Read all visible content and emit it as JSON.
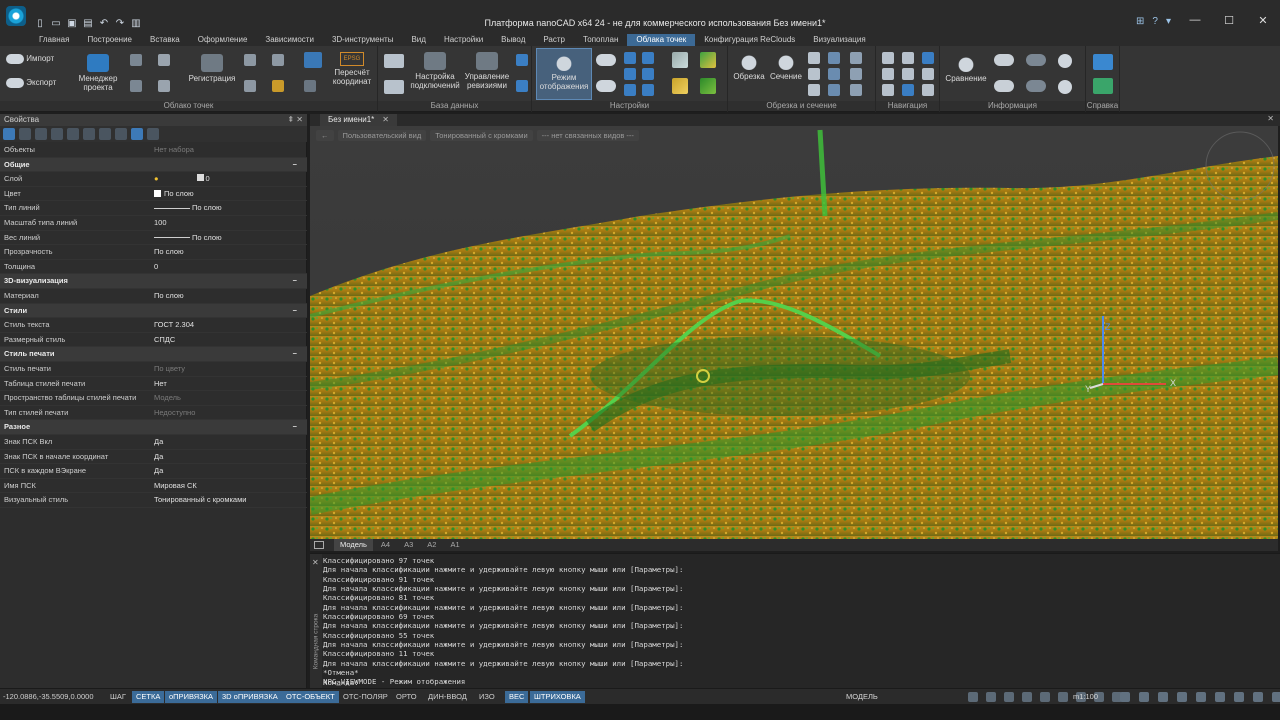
{
  "window": {
    "title": "Платформа nanoCAD x64 24 - не для коммерческого использования Без имени1*",
    "controls": [
      "—",
      "☐",
      "✕"
    ],
    "title_icons": [
      "⊞",
      "?",
      "▾"
    ]
  },
  "menu_tabs": [
    "Главная",
    "Построение",
    "Вставка",
    "Оформление",
    "Зависимости",
    "3D-инструменты",
    "Вид",
    "Настройки",
    "Вывод",
    "Растр",
    "Топоплан",
    "Облака точек",
    "Конфигурация ReClouds",
    "Визуализация"
  ],
  "active_menu_tab": "Облака точек",
  "ribbon": {
    "groups": {
      "cloud": "Облако точек",
      "database": "База данных",
      "settings": "Настройки",
      "clip": "Обрезка и сечение",
      "nav": "Навигация",
      "info": "Информация",
      "help_group": ""
    },
    "buttons": {
      "import": "Импорт",
      "export": "Экспорт",
      "project_manager": "Менеджер проекта",
      "registration": "Регистрация",
      "recalc": "Пересчёт координат",
      "epsg": "EPSG",
      "connections": "Настройка подключений",
      "revisions": "Управление ревизиями",
      "display_mode": "Режим отображения",
      "clip": "Обрезка",
      "section": "Сечение",
      "compare": "Сравнение",
      "help": "Справка"
    }
  },
  "properties": {
    "header": "Свойства",
    "header_icons": "⇞ ✕",
    "objects_label": "Объекты",
    "objects_value": "Нет набора",
    "sections": [
      {
        "title": "Общие",
        "rows": [
          {
            "k": "Слой",
            "v": "0"
          },
          {
            "k": "Цвет",
            "v": "По слою"
          },
          {
            "k": "Тип линий",
            "v": "По слою"
          },
          {
            "k": "Масштаб типа линий",
            "v": "100"
          },
          {
            "k": "Вес линий",
            "v": "По слою"
          },
          {
            "k": "Прозрачность",
            "v": "По слою"
          },
          {
            "k": "Толщина",
            "v": "0"
          }
        ]
      },
      {
        "title": "3D-визуализация",
        "rows": [
          {
            "k": "Материал",
            "v": "По слою"
          }
        ]
      },
      {
        "title": "Стили",
        "rows": [
          {
            "k": "Стиль текста",
            "v": "ГОСТ 2.304"
          },
          {
            "k": "Размерный стиль",
            "v": "СПДС"
          }
        ]
      },
      {
        "title": "Стиль печати",
        "rows": [
          {
            "k": "Стиль печати",
            "v": "По цвету",
            "dim": true
          },
          {
            "k": "Таблица стилей печати",
            "v": "Нет"
          },
          {
            "k": "Пространство таблицы стилей печати",
            "v": "Модель",
            "dim": true
          },
          {
            "k": "Тип стилей печати",
            "v": "Недоступно",
            "dim": true
          }
        ]
      },
      {
        "title": "Разное",
        "rows": [
          {
            "k": "Знак ПСК Вкл",
            "v": "Да"
          },
          {
            "k": "Знак ПСК в начале координат",
            "v": "Да"
          },
          {
            "k": "ПСК в каждом ВЭкране",
            "v": "Да"
          },
          {
            "k": "Имя ПСК",
            "v": "Мировая СК"
          },
          {
            "k": "Визуальный стиль",
            "v": "Тонированный с кромками"
          }
        ]
      }
    ]
  },
  "document": {
    "tab": "Без имени1*",
    "view_controls": [
      "←",
      "Пользовательский вид",
      "Тонированный с кромками",
      "--- нет связанных видов ---"
    ]
  },
  "axes": {
    "z": "Z",
    "x": "X",
    "y": "Y"
  },
  "layout_tabs": [
    "Модель",
    "A4",
    "A3",
    "A2",
    "A1"
  ],
  "command": {
    "side_label": "Командная строка",
    "lines": [
      "Классифицировано 97 точек",
      "Для начала классификации нажмите и удерживайте левую кнопку мыши или [Параметры]:",
      "Классифицировано 91 точек",
      "Для начала классификации нажмите и удерживайте левую кнопку мыши или [Параметры]:",
      "Классифицировано 81 точек",
      "Для начала классификации нажмите и удерживайте левую кнопку мыши или [Параметры]:",
      "Классифицировано 69 точек",
      "Для начала классификации нажмите и удерживайте левую кнопку мыши или [Параметры]:",
      "Классифицировано 55 точек",
      "Для начала классификации нажмите и удерживайте левую кнопку мыши или [Параметры]:",
      "Классифицировано 11 точек",
      "Для начала классификации нажмите и удерживайте левую кнопку мыши или [Параметры]:",
      "*Отмена*",
      "NPC_VIEWMODE - Режим отображения",
      "NPC_VIEWMODE - Режим отображения"
    ],
    "prompt": "Команда:"
  },
  "status": {
    "coords": "-120.0886,-35.5509,0.0000",
    "toggles": [
      {
        "label": "ШАГ",
        "on": false
      },
      {
        "label": "СЕТКА",
        "on": true
      },
      {
        "label": "оПРИВЯЗКА",
        "on": true
      },
      {
        "label": "3D оПРИВЯЗКА",
        "on": true
      },
      {
        "label": "ОТС-ОБЪЕКТ",
        "on": true
      },
      {
        "label": "ОТС-ПОЛЯР",
        "on": false
      },
      {
        "label": "ОРТО",
        "on": false
      },
      {
        "label": "ДИН-ВВОД",
        "on": false
      },
      {
        "label": "ИЗО",
        "on": false
      },
      {
        "label": "ВЕС",
        "on": true
      },
      {
        "label": "ШТРИХОВКА",
        "on": true
      }
    ],
    "model": "МОДЕЛЬ",
    "scale": "m1:100"
  },
  "colors": {
    "accent": "#3c6a96",
    "point_yellow": "#c49a1e",
    "point_green": "#2f9a2c"
  }
}
